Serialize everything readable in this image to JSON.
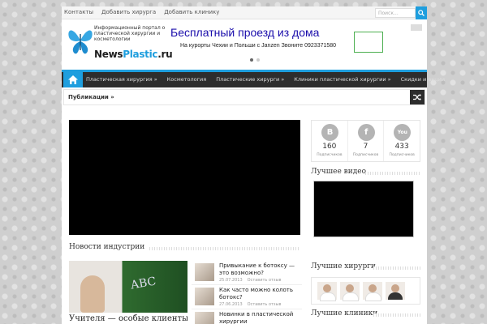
{
  "topbar": {
    "links": [
      "Контакты",
      "Добавить хирурга",
      "Добавить клинику"
    ],
    "search_placeholder": "Поиск..."
  },
  "logo": {
    "tagline": "Информационный портал о пластической хирургии и косметологии",
    "name_main": "News",
    "name_accent": "Plastic",
    "name_suffix": ".ru"
  },
  "ad": {
    "title": "Бесплатный проезд из дома",
    "subtitle": "На курорты Чехии и Польши с Janzen Звоните 0923371580"
  },
  "nav": {
    "items": [
      "Пластическая хирургия »",
      "Косметология",
      "Пластические хирурги »",
      "Клиники пластической хирургии »",
      "Скидки и акции"
    ]
  },
  "ticker": {
    "label": "Публикации »"
  },
  "sections": {
    "industry_news": "Новости индустрии",
    "best_video": "Лучшее видео",
    "best_surgeons": "Лучшие хирурги",
    "best_clinics": "Лучшие клиники"
  },
  "feature": {
    "title": "Учителя — особые клиенты"
  },
  "news": [
    {
      "title": "Привыкание к ботоксу — это возможно?",
      "date": "25.07.2013",
      "comment": "Оставить отзыв"
    },
    {
      "title": "Как часто можно колоть ботокс?",
      "date": "27.06.2013",
      "comment": "Оставить отзыв"
    },
    {
      "title": "Новинки в пластической хирургии",
      "date": "",
      "comment": ""
    }
  ],
  "social": [
    {
      "icon": "B",
      "count": "160",
      "label": "Подписчиков",
      "color": "#b4b4b4"
    },
    {
      "icon": "f",
      "count": "7",
      "label": "Подписчиков",
      "color": "#b4b4b4"
    },
    {
      "icon": "You",
      "count": "433",
      "label": "Подписчиков",
      "color": "#b4b4b4"
    }
  ],
  "colors": {
    "accent": "#1e9ede",
    "nav_bg": "#2d2d2d"
  }
}
